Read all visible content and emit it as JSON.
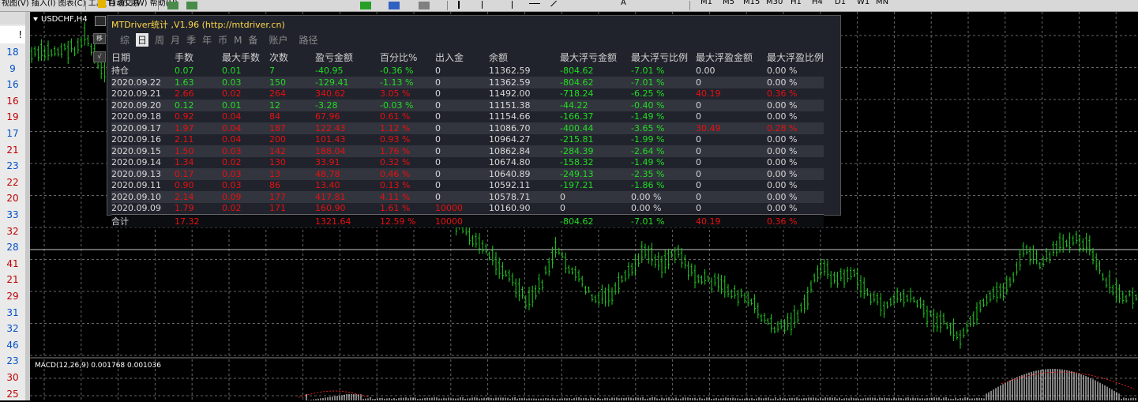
{
  "toolbar": {
    "menu_label": "视图(V) 插入(I) 图表(C) 工具(T) 窗口(W) 帮助(H)",
    "autotrade_label": "自动交易",
    "timeframes": [
      "M1",
      "M5",
      "M15",
      "M30",
      "H1",
      "H4",
      "D1",
      "W1",
      "MN"
    ]
  },
  "left_numbers": [
    {
      "v": "18",
      "c": "b"
    },
    {
      "v": "9",
      "c": "b"
    },
    {
      "v": "16",
      "c": "b"
    },
    {
      "v": "16",
      "c": "r"
    },
    {
      "v": "19",
      "c": "r"
    },
    {
      "v": "17",
      "c": "b"
    },
    {
      "v": "21",
      "c": "r"
    },
    {
      "v": "23",
      "c": "b"
    },
    {
      "v": "22",
      "c": "r"
    },
    {
      "v": "20",
      "c": "r"
    },
    {
      "v": "33",
      "c": "b"
    },
    {
      "v": "32",
      "c": "r"
    },
    {
      "v": "28",
      "c": "b"
    },
    {
      "v": "41",
      "c": "r"
    },
    {
      "v": "21",
      "c": "r"
    },
    {
      "v": "29",
      "c": "r"
    },
    {
      "v": "31",
      "c": "b"
    },
    {
      "v": "32",
      "c": "b"
    },
    {
      "v": "46",
      "c": "b"
    },
    {
      "v": "23",
      "c": "b"
    },
    {
      "v": "30",
      "c": "r"
    },
    {
      "v": "25",
      "c": "r"
    }
  ],
  "left_excl": "!",
  "chart": {
    "symbol": "USDCHF,H4",
    "macd_label": "MACD(12,26,9) 0.001768 0.001036",
    "side_btn1": "移",
    "side_btn2": "√"
  },
  "panel": {
    "title": "MTDriver统计 ,V1.96 (http://mtdriver.cn)",
    "tabs": [
      "综",
      "日",
      "周",
      "月",
      "季",
      "年",
      "币",
      "M",
      "备",
      "账户",
      "路径"
    ],
    "active_tab": "日",
    "headers": [
      "日期",
      "手数",
      "最大手数",
      "次数",
      "盈亏金额",
      "百分比%",
      "出入金",
      "余额",
      "最大浮亏金额",
      "最大浮亏比例",
      "最大浮盈金额",
      "最大浮盈比例"
    ],
    "rows": [
      {
        "d": "持仓",
        "lots": "0.07",
        "maxlots": "0.01",
        "count": "7",
        "pl": "-40.95",
        "pct": "-0.36 %",
        "io": "0",
        "bal": "11362.59",
        "mfl": "-804.62",
        "mflp": "-7.01 %",
        "mfp": "0.00",
        "mfpp": "0.00 %",
        "c": [
          "g",
          "g",
          "g",
          "g",
          "g",
          "w",
          "w",
          "g",
          "g",
          "w",
          "w"
        ]
      },
      {
        "d": "2020.09.22",
        "lots": "1.63",
        "maxlots": "0.03",
        "count": "150",
        "pl": "-129.41",
        "pct": "-1.13 %",
        "io": "0",
        "bal": "11362.59",
        "mfl": "-804.62",
        "mflp": "-7.01 %",
        "mfp": "0",
        "mfpp": "0.00 %",
        "c": [
          "g",
          "g",
          "g",
          "g",
          "g",
          "w",
          "w",
          "g",
          "g",
          "w",
          "w"
        ]
      },
      {
        "d": "2020.09.21",
        "lots": "2.66",
        "maxlots": "0.02",
        "count": "264",
        "pl": "340.62",
        "pct": "3.05 %",
        "io": "0",
        "bal": "11492.00",
        "mfl": "-718.24",
        "mflp": "-6.25 %",
        "mfp": "40.19",
        "mfpp": "0.36 %",
        "c": [
          "r",
          "r",
          "r",
          "r",
          "r",
          "w",
          "w",
          "g",
          "g",
          "r",
          "r"
        ]
      },
      {
        "d": "2020.09.20",
        "lots": "0.12",
        "maxlots": "0.01",
        "count": "12",
        "pl": "-3.28",
        "pct": "-0.03 %",
        "io": "0",
        "bal": "11151.38",
        "mfl": "-44.22",
        "mflp": "-0.40 %",
        "mfp": "0",
        "mfpp": "0.00 %",
        "c": [
          "g",
          "g",
          "g",
          "g",
          "g",
          "w",
          "w",
          "g",
          "g",
          "w",
          "w"
        ]
      },
      {
        "d": "2020.09.18",
        "lots": "0.92",
        "maxlots": "0.04",
        "count": "84",
        "pl": "67.96",
        "pct": "0.61 %",
        "io": "0",
        "bal": "11154.66",
        "mfl": "-166.37",
        "mflp": "-1.49 %",
        "mfp": "0",
        "mfpp": "0.00 %",
        "c": [
          "r",
          "r",
          "r",
          "r",
          "r",
          "w",
          "w",
          "g",
          "g",
          "w",
          "w"
        ]
      },
      {
        "d": "2020.09.17",
        "lots": "1.97",
        "maxlots": "0.04",
        "count": "187",
        "pl": "122.43",
        "pct": "1.12 %",
        "io": "0",
        "bal": "11086.70",
        "mfl": "-400.44",
        "mflp": "-3.65 %",
        "mfp": "30.49",
        "mfpp": "0.28 %",
        "c": [
          "r",
          "r",
          "r",
          "r",
          "r",
          "w",
          "w",
          "g",
          "g",
          "r",
          "r"
        ]
      },
      {
        "d": "2020.09.16",
        "lots": "2.11",
        "maxlots": "0.04",
        "count": "200",
        "pl": "101.43",
        "pct": "0.93 %",
        "io": "0",
        "bal": "10964.27",
        "mfl": "-215.81",
        "mflp": "-1.99 %",
        "mfp": "0",
        "mfpp": "0.00 %",
        "c": [
          "r",
          "r",
          "r",
          "r",
          "r",
          "w",
          "w",
          "g",
          "g",
          "w",
          "w"
        ]
      },
      {
        "d": "2020.09.15",
        "lots": "1.50",
        "maxlots": "0.03",
        "count": "142",
        "pl": "188.04",
        "pct": "1.76 %",
        "io": "0",
        "bal": "10862.84",
        "mfl": "-284.39",
        "mflp": "-2.64 %",
        "mfp": "0",
        "mfpp": "0.00 %",
        "c": [
          "r",
          "r",
          "r",
          "r",
          "r",
          "w",
          "w",
          "g",
          "g",
          "w",
          "w"
        ]
      },
      {
        "d": "2020.09.14",
        "lots": "1.34",
        "maxlots": "0.02",
        "count": "130",
        "pl": "33.91",
        "pct": "0.32 %",
        "io": "0",
        "bal": "10674.80",
        "mfl": "-158.32",
        "mflp": "-1.49 %",
        "mfp": "0",
        "mfpp": "0.00 %",
        "c": [
          "r",
          "r",
          "r",
          "r",
          "r",
          "w",
          "w",
          "g",
          "g",
          "w",
          "w"
        ]
      },
      {
        "d": "2020.09.13",
        "lots": "0.17",
        "maxlots": "0.03",
        "count": "13",
        "pl": "48.78",
        "pct": "0.46 %",
        "io": "0",
        "bal": "10640.89",
        "mfl": "-249.13",
        "mflp": "-2.35 %",
        "mfp": "0",
        "mfpp": "0.00 %",
        "c": [
          "r",
          "r",
          "r",
          "r",
          "r",
          "w",
          "w",
          "g",
          "g",
          "w",
          "w"
        ]
      },
      {
        "d": "2020.09.11",
        "lots": "0.90",
        "maxlots": "0.03",
        "count": "86",
        "pl": "13.40",
        "pct": "0.13 %",
        "io": "0",
        "bal": "10592.11",
        "mfl": "-197.21",
        "mflp": "-1.86 %",
        "mfp": "0",
        "mfpp": "0.00 %",
        "c": [
          "r",
          "r",
          "r",
          "r",
          "r",
          "w",
          "w",
          "g",
          "g",
          "w",
          "w"
        ]
      },
      {
        "d": "2020.09.10",
        "lots": "2.14",
        "maxlots": "0.09",
        "count": "177",
        "pl": "417.81",
        "pct": "4.11 %",
        "io": "0",
        "bal": "10578.71",
        "mfl": "0",
        "mflp": "0.00 %",
        "mfp": "0",
        "mfpp": "0.00 %",
        "c": [
          "r",
          "r",
          "r",
          "r",
          "r",
          "w",
          "w",
          "w",
          "w",
          "w",
          "w"
        ]
      },
      {
        "d": "2020.09.09",
        "lots": "1.79",
        "maxlots": "0.02",
        "count": "171",
        "pl": "160.90",
        "pct": "1.61 %",
        "io": "10000",
        "bal": "10160.90",
        "mfl": "0",
        "mflp": "0.00 %",
        "mfp": "0",
        "mfpp": "0.00 %",
        "c": [
          "r",
          "r",
          "r",
          "r",
          "r",
          "r",
          "w",
          "w",
          "w",
          "w",
          "w"
        ]
      }
    ],
    "total": {
      "d": "合计",
      "lots": "17.32",
      "maxlots": "",
      "count": "",
      "pl": "1321.64",
      "pct": "12.59 %",
      "io": "10000",
      "bal": "",
      "mfl": "-804.62",
      "mflp": "-7.01 %",
      "mfp": "40.19",
      "mfpp": "0.36 %",
      "c": [
        "r",
        "w",
        "w",
        "r",
        "r",
        "r",
        "w",
        "g",
        "g",
        "r",
        "r"
      ]
    }
  },
  "colors": {
    "grid": "#666666",
    "candle": "#22cc22",
    "panel_bg": "#20232c",
    "title": "#ffd84a"
  }
}
